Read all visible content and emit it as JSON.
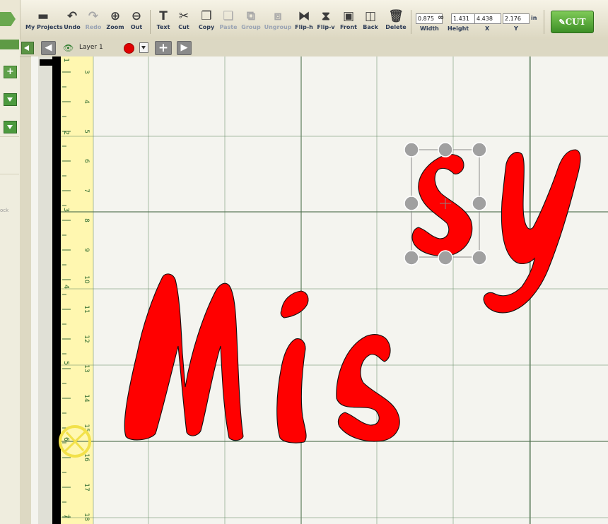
{
  "toolbar": {
    "buttons": [
      {
        "id": "my-projects",
        "label": "My Projects",
        "icon": "folder-icon",
        "enabled": true
      },
      {
        "id": "undo",
        "label": "Undo",
        "icon": "undo-icon",
        "enabled": true
      },
      {
        "id": "redo",
        "label": "Redo",
        "icon": "redo-icon",
        "enabled": false
      },
      {
        "id": "zoom",
        "label": "Zoom",
        "icon": "zoom-in-icon",
        "enabled": true
      },
      {
        "id": "out",
        "label": "Out",
        "icon": "zoom-out-icon",
        "enabled": true
      },
      {
        "id": "text",
        "label": "Text",
        "icon": "text-icon",
        "enabled": true
      },
      {
        "id": "cut",
        "label": "Cut",
        "icon": "scissors-icon",
        "enabled": true
      },
      {
        "id": "copy",
        "label": "Copy",
        "icon": "copy-icon",
        "enabled": true
      },
      {
        "id": "paste",
        "label": "Paste",
        "icon": "paste-icon",
        "enabled": false
      },
      {
        "id": "group",
        "label": "Group",
        "icon": "group-icon",
        "enabled": false
      },
      {
        "id": "ungroup",
        "label": "Ungroup",
        "icon": "ungroup-icon",
        "enabled": false
      },
      {
        "id": "flip-h",
        "label": "Flip-h",
        "icon": "flip-horizontal-icon",
        "enabled": true
      },
      {
        "id": "flip-v",
        "label": "Flip-v",
        "icon": "flip-vertical-icon",
        "enabled": true
      },
      {
        "id": "front",
        "label": "Front",
        "icon": "bring-front-icon",
        "enabled": true
      },
      {
        "id": "back",
        "label": "Back",
        "icon": "send-back-icon",
        "enabled": true
      },
      {
        "id": "delete",
        "label": "Delete",
        "icon": "trash-icon",
        "enabled": true
      }
    ],
    "dimensions": {
      "width": {
        "label": "Width",
        "value": "0.875"
      },
      "height": {
        "label": "Height",
        "value": "1.431"
      },
      "x": {
        "label": "X",
        "value": "4.438"
      },
      "y": {
        "label": "Y",
        "value": "2.176"
      },
      "unit": "in",
      "lock_icon": "chain-link-icon"
    },
    "cut_button": {
      "label": "CUT",
      "icon": "knife-icon",
      "color": "#4caf3a"
    }
  },
  "left_panel": {
    "lock_text": "ock",
    "icons": [
      "arrow-right-icon",
      "plus-icon",
      "dropdown-icon",
      "dropdown-icon"
    ]
  },
  "layer_bar": {
    "layer_name": "Layer 1",
    "layer_color": "#e00000",
    "icons": [
      "collapse-left-icon",
      "arrow-left-icon",
      "eye-icon",
      "color-dot",
      "dropdown-icon",
      "add-layer-icon",
      "arrow-right-icon"
    ]
  },
  "ruler": {
    "major_labels": [
      "1",
      "2",
      "3",
      "4",
      "5",
      "6",
      "7"
    ],
    "minor_labels": [
      "3",
      "4",
      "5",
      "6",
      "7",
      "8",
      "9",
      "10",
      "11",
      "12",
      "13",
      "14",
      "15",
      "16",
      "17",
      "18"
    ]
  },
  "canvas": {
    "shapes": [
      {
        "id": "M",
        "glyph": "M",
        "fill": "#ff0000"
      },
      {
        "id": "i",
        "glyph": "i",
        "fill": "#ff0000"
      },
      {
        "id": "s-lower",
        "glyph": "s",
        "fill": "#ff0000"
      },
      {
        "id": "s-selected",
        "glyph": "s",
        "fill": "#ff0000",
        "selected": true
      },
      {
        "id": "y",
        "glyph": "y",
        "fill": "#ff0000"
      }
    ],
    "blade_icon": "blade-position-icon"
  },
  "colors": {
    "accent_green": "#4caf3a",
    "shape_red": "#ff0000",
    "ruler_yellow": "#fff7b0",
    "grid_green": "#4d6f4d"
  }
}
